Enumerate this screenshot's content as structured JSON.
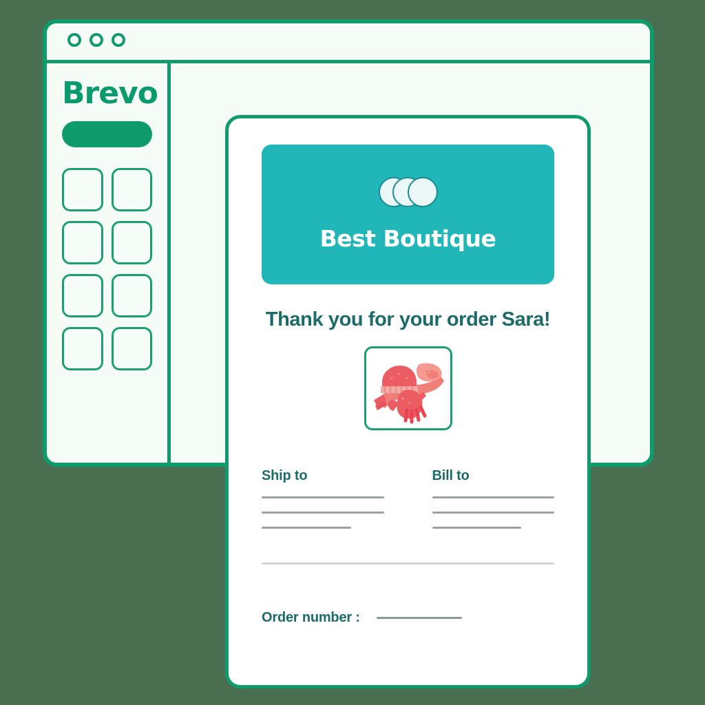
{
  "background_color": "#4a6e50",
  "browser": {
    "name": "brevo-app-window",
    "accent_color": "#0f9b6c",
    "titlebar": {
      "dots": [
        "window-dot-1",
        "window-dot-2",
        "window-dot-3"
      ]
    },
    "sidebar": {
      "logo_text": "Brevo",
      "primary_button_label": "",
      "tiles": [
        {
          "name": "sidebar-tile-1"
        },
        {
          "name": "sidebar-tile-2"
        },
        {
          "name": "sidebar-tile-3"
        },
        {
          "name": "sidebar-tile-4"
        },
        {
          "name": "sidebar-tile-5"
        },
        {
          "name": "sidebar-tile-6"
        },
        {
          "name": "sidebar-tile-7"
        },
        {
          "name": "sidebar-tile-8"
        }
      ]
    }
  },
  "email_card": {
    "header": {
      "background_color": "#21b6b8",
      "logo_icon": "three-overlapping-circles-icon",
      "brand_name": "Best Boutique"
    },
    "greeting": "Thank you for your order Sara!",
    "product_image": {
      "icon": "winter-accessories-photo",
      "alt": "Red knit hat, scarf and gloves"
    },
    "ship_to": {
      "title": "Ship to",
      "placeholder_lines": 3
    },
    "bill_to": {
      "title": "Bill to",
      "placeholder_lines": 3
    },
    "order": {
      "label": "Order number :",
      "value": ""
    },
    "text_color": "#1d6b68",
    "border_color": "#0f9b6c"
  }
}
